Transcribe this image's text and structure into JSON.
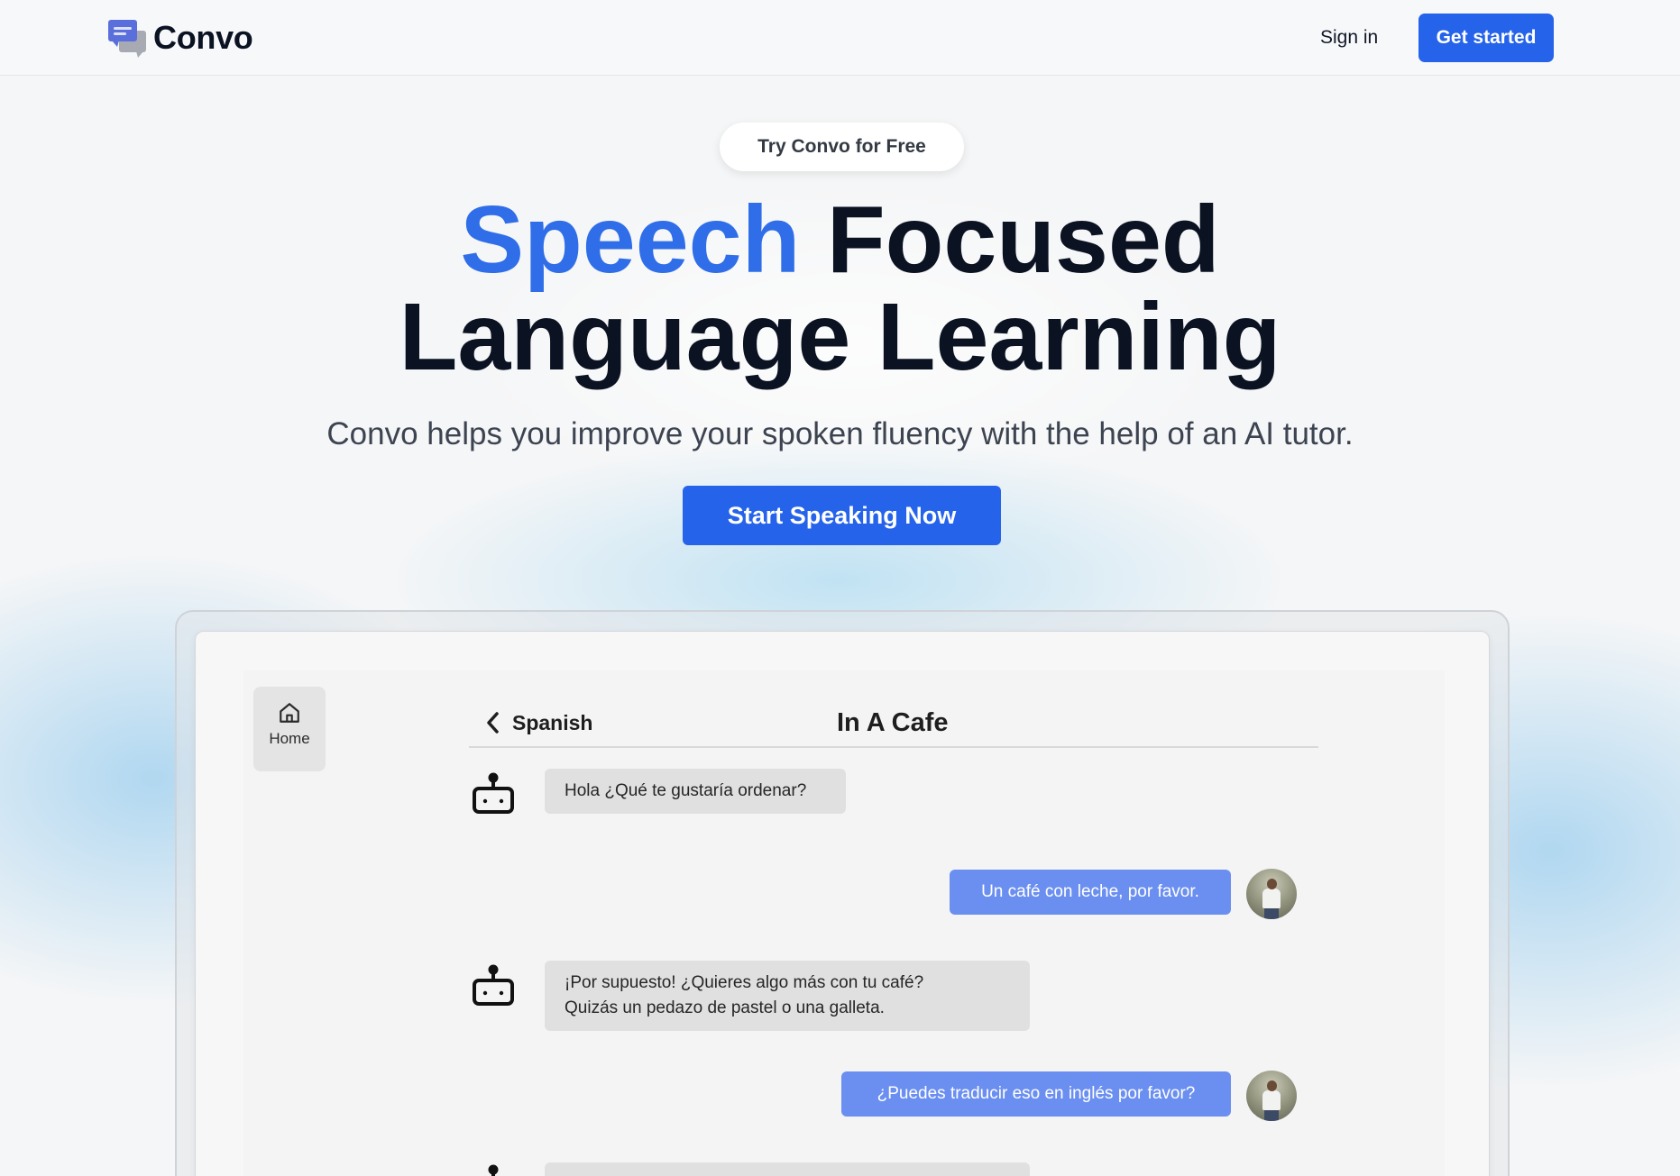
{
  "header": {
    "brand_name": "Convo",
    "signin_label": "Sign in",
    "get_started_label": "Get started"
  },
  "hero": {
    "pill_label": "Try Convo for Free",
    "headline_accent": "Speech",
    "headline_rest": "Focused",
    "headline_line2": "Language Learning",
    "subhead": "Convo helps you improve your spoken fluency with the help of an AI tutor.",
    "cta_label": "Start Speaking Now"
  },
  "app_preview": {
    "home_label": "Home",
    "back_label": "Spanish",
    "chat_title": "In A Cafe",
    "messages": [
      {
        "role": "bot",
        "lines": [
          "Hola ¿Qué te gustaría ordenar?"
        ]
      },
      {
        "role": "user",
        "lines": [
          "Un café con leche, por favor."
        ]
      },
      {
        "role": "bot",
        "lines": [
          "¡Por supuesto! ¿Quieres algo más con tu café?",
          "Quizás un pedazo de pastel o una galleta."
        ]
      },
      {
        "role": "user",
        "lines": [
          "¿Puedes traducir eso en inglés por favor?"
        ]
      }
    ]
  },
  "colors": {
    "accent": "#2f6ee8",
    "primary_button": "#2563eb",
    "user_bubble": "#6b8ff0",
    "bot_bubble": "#e0e0e0"
  },
  "icons": [
    "chat-bubbles-logo-icon",
    "home-icon",
    "chevron-left-icon",
    "robot-icon",
    "user-avatar"
  ]
}
